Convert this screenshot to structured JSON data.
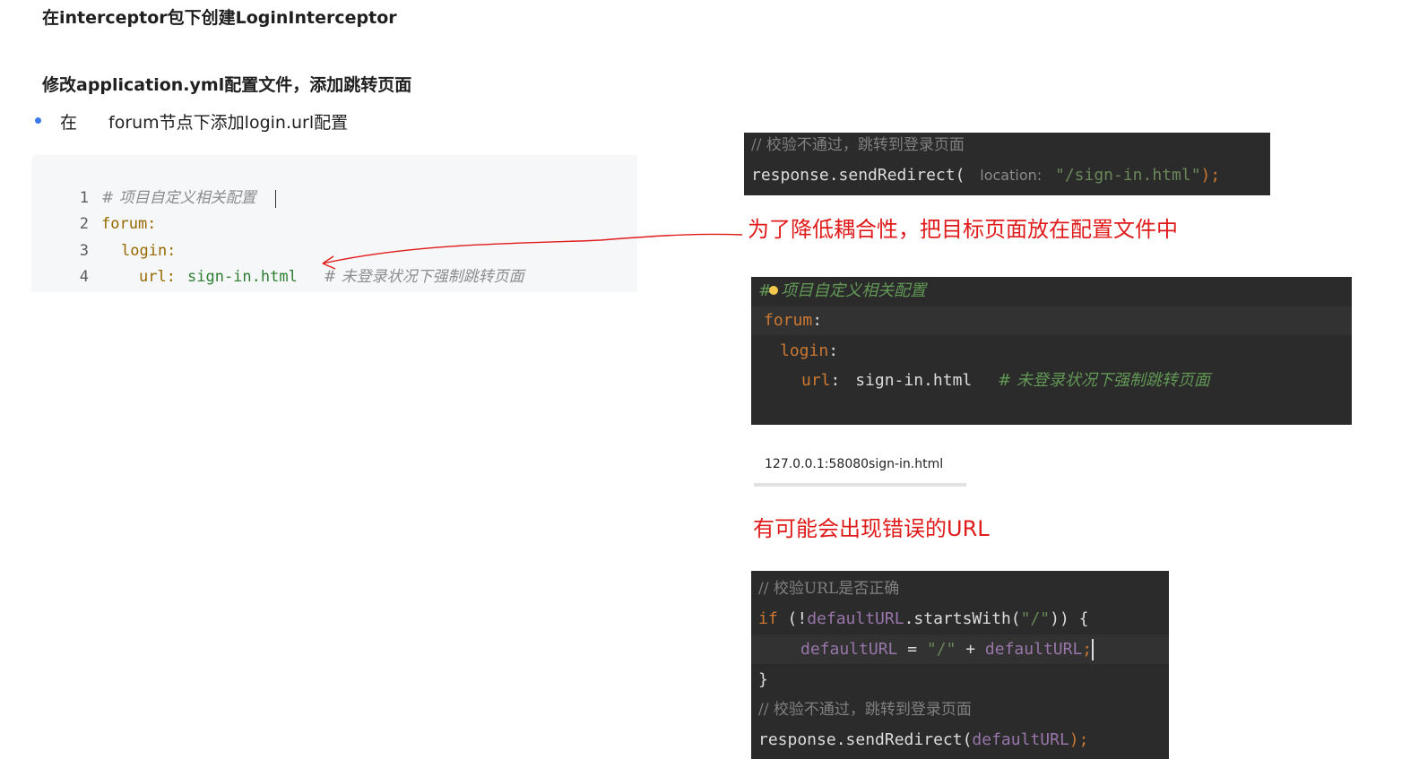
{
  "headings": {
    "interceptor": "在interceptor包下创建LoginInterceptor",
    "modify_yml": "修改application.yml配置文件，添加跳转页面"
  },
  "bullet": {
    "prefix": "在",
    "text": "forum节点下添加login.url配置"
  },
  "yml_block": {
    "lines": [
      {
        "num": "1",
        "comment": "# 项目自定义相关配置"
      },
      {
        "num": "2",
        "key": "forum:"
      },
      {
        "num": "3",
        "key": "login:"
      },
      {
        "num": "4",
        "key": "url:",
        "value": "sign-in.html",
        "comment": "# 未登录状况下强制跳转页面"
      }
    ]
  },
  "snippet_redirect": {
    "comment": "// 校验不通过，跳转到登录页面",
    "call": "response.sendRedirect(",
    "param_hint": "location:",
    "arg": "\"/sign-in.html\"",
    "end": ");"
  },
  "annotations": {
    "config_note": "为了降低耦合性，把目标页面放在配置文件中",
    "url_error_note": "有可能会出现错误的URL",
    "colors": {
      "note": "#e01b1b",
      "arrow": "#e01b1b"
    }
  },
  "snippet_yml_dark": {
    "comment": "项目自定义相关配置",
    "forum": "forum",
    "login": "login",
    "url_key": "url",
    "url_value": "sign-in.html",
    "url_comment": "# 未登录状况下强制跳转页面",
    "colon": ":"
  },
  "url_preview": {
    "text": "127.0.0.1:58080sign-in.html"
  },
  "snippet_check": {
    "comment1": "// 校验URL是否正确",
    "if_kw": "if",
    "cond_open": " (!",
    "var": "defaultURL",
    "method": ".startsWith(",
    "slash": "\"/\"",
    "cond_close": ")) {",
    "assign_var": "defaultURL",
    "assign_op": " = ",
    "assign_plus": " + ",
    "assign_var2": "defaultURL",
    "semicolon": ";",
    "close_brace": "}",
    "comment2": "// 校验不通过，跳转到登录页面",
    "call": "response.sendRedirect(",
    "call_arg": "defaultURL",
    "call_end": ");"
  }
}
